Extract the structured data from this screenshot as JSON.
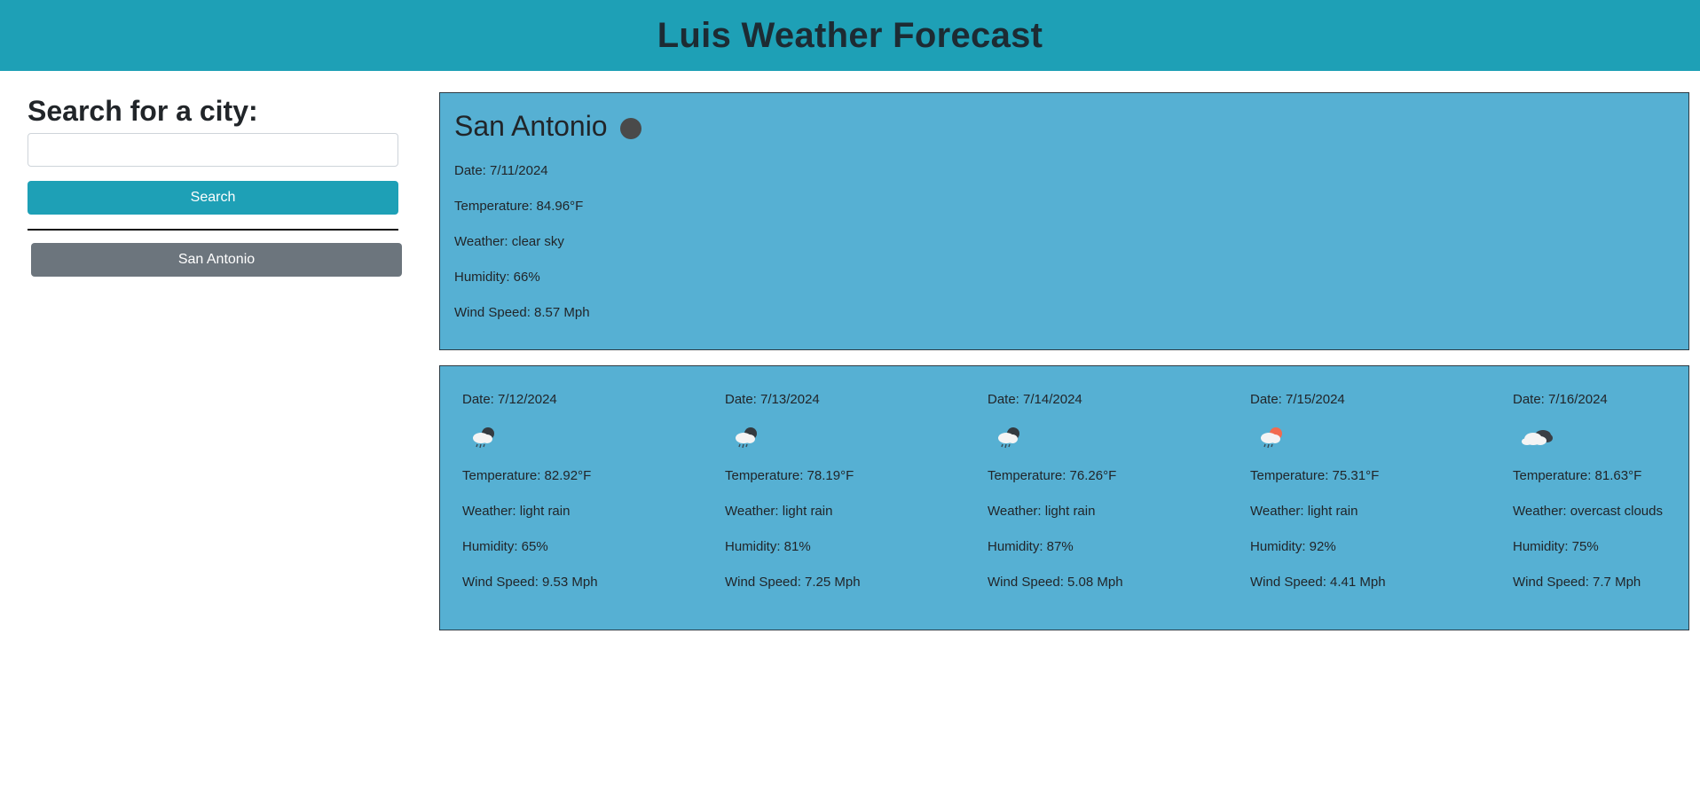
{
  "header": {
    "title": "Luis Weather Forecast"
  },
  "sidebar": {
    "heading": "Search for a city:",
    "search_input_value": "",
    "search_input_placeholder": "",
    "search_button_label": "Search",
    "history": [
      {
        "label": "San Antonio"
      }
    ]
  },
  "current": {
    "city": "San Antonio",
    "icon": "dark-circle-icon",
    "date": "Date: 7/11/2024",
    "temperature": "Temperature: 84.96°F",
    "weather": "Weather: clear sky",
    "humidity": "Humidity: 66%",
    "wind": "Wind Speed: 8.57 Mph"
  },
  "forecast": [
    {
      "date": "Date: 7/12/2024",
      "icon": "rain-cloud-icon",
      "temperature": "Temperature: 82.92°F",
      "weather": "Weather: light rain",
      "humidity": "Humidity: 65%",
      "wind": "Wind Speed: 9.53 Mph"
    },
    {
      "date": "Date: 7/13/2024",
      "icon": "rain-cloud-icon",
      "temperature": "Temperature: 78.19°F",
      "weather": "Weather: light rain",
      "humidity": "Humidity: 81%",
      "wind": "Wind Speed: 7.25 Mph"
    },
    {
      "date": "Date: 7/14/2024",
      "icon": "rain-cloud-icon",
      "temperature": "Temperature: 76.26°F",
      "weather": "Weather: light rain",
      "humidity": "Humidity: 87%",
      "wind": "Wind Speed: 5.08 Mph"
    },
    {
      "date": "Date: 7/15/2024",
      "icon": "sun-rain-cloud-icon",
      "temperature": "Temperature: 75.31°F",
      "weather": "Weather: light rain",
      "humidity": "Humidity: 92%",
      "wind": "Wind Speed: 4.41 Mph"
    },
    {
      "date": "Date: 7/16/2024",
      "icon": "overcast-clouds-icon",
      "temperature": "Temperature: 81.63°F",
      "weather": "Weather: overcast clouds",
      "humidity": "Humidity: 75%",
      "wind": "Wind Speed: 7.7 Mph"
    }
  ],
  "colors": {
    "header_bg": "#1ea0b6",
    "card_bg": "#56b0d3",
    "search_button_bg": "#1ea0b6",
    "history_button_bg": "#6c757d"
  }
}
